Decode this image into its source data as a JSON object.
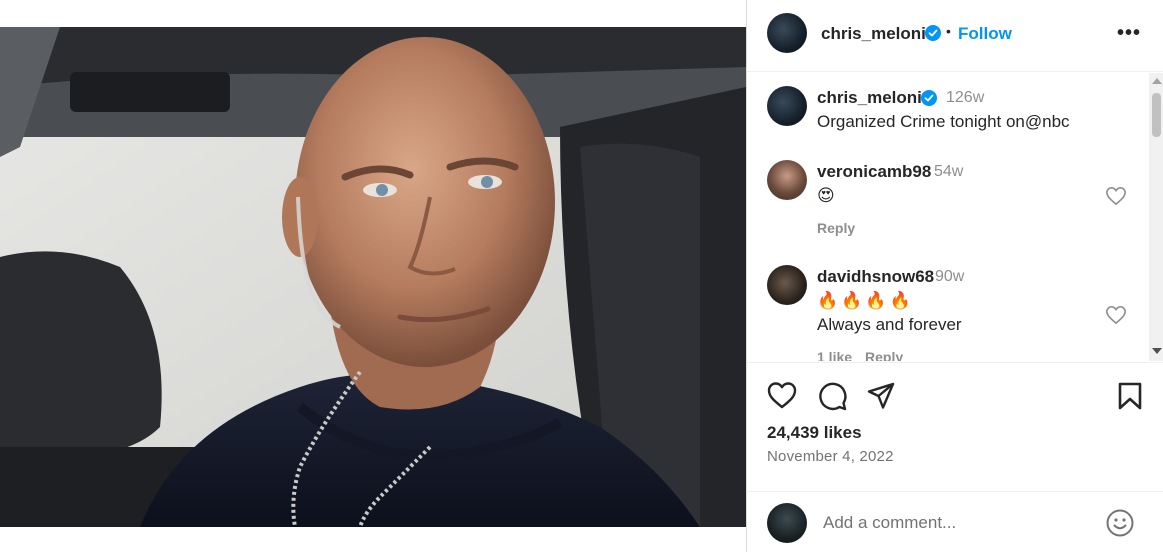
{
  "post": {
    "author": "chris_meloni",
    "follow_label": "Follow",
    "separator": "•",
    "more_label": "•••",
    "likes": "24,439 likes",
    "date": "November 4, 2022",
    "add_comment_placeholder": "Add a comment..."
  },
  "caption": {
    "username": "chris_meloni",
    "time": "126w",
    "text": "Organized Crime tonight on@nbc"
  },
  "comments": [
    {
      "username": "veronicamb98",
      "time": "54w",
      "emoji": "😍",
      "text": "",
      "likes_label": "",
      "reply_label": "Reply"
    },
    {
      "username": "davidhsnow68",
      "time": "90w",
      "emoji": "🔥🔥🔥🔥",
      "text": "Always and forever",
      "likes_label": "1 like",
      "reply_label": "Reply"
    }
  ],
  "icons": {
    "verified": "verified-badge-icon",
    "like": "heart-icon",
    "comment": "comment-bubble-icon",
    "share": "paper-plane-icon",
    "save": "bookmark-icon",
    "emoji": "smiley-icon",
    "more": "more-options-icon"
  },
  "colors": {
    "accent": "#0095f6",
    "verified": "#0095f6",
    "text": "#262626",
    "muted": "#8e8e8e"
  }
}
